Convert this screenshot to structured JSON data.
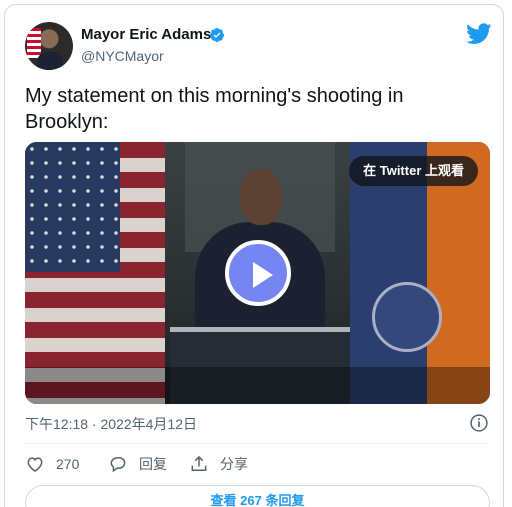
{
  "user": {
    "name": "Mayor Eric Adams",
    "handle": "@NYCMayor",
    "verified_icon": "verified-badge-icon",
    "avatar_icon": "avatar"
  },
  "brand": {
    "icon": "twitter-bird-icon",
    "color": "#1d9bf0"
  },
  "tweet": {
    "text_line1": "My statement on this morning's shooting in",
    "text_line2": "Brooklyn:"
  },
  "media": {
    "overlay_label": "在 Twitter 上观看",
    "play_icon": "play-icon",
    "play_button_color": "#7586f3"
  },
  "meta": {
    "timestamp": "下午12:18 · 2022年4月12日",
    "info_icon": "info-icon"
  },
  "actions": {
    "like_count": "270",
    "reply_label": "回复",
    "share_label": "分享"
  },
  "footer": {
    "view_replies_label": "查看 267 条回复"
  },
  "colors": {
    "text_primary": "#0f1419",
    "text_secondary": "#536471",
    "border": "#cfd9de"
  }
}
